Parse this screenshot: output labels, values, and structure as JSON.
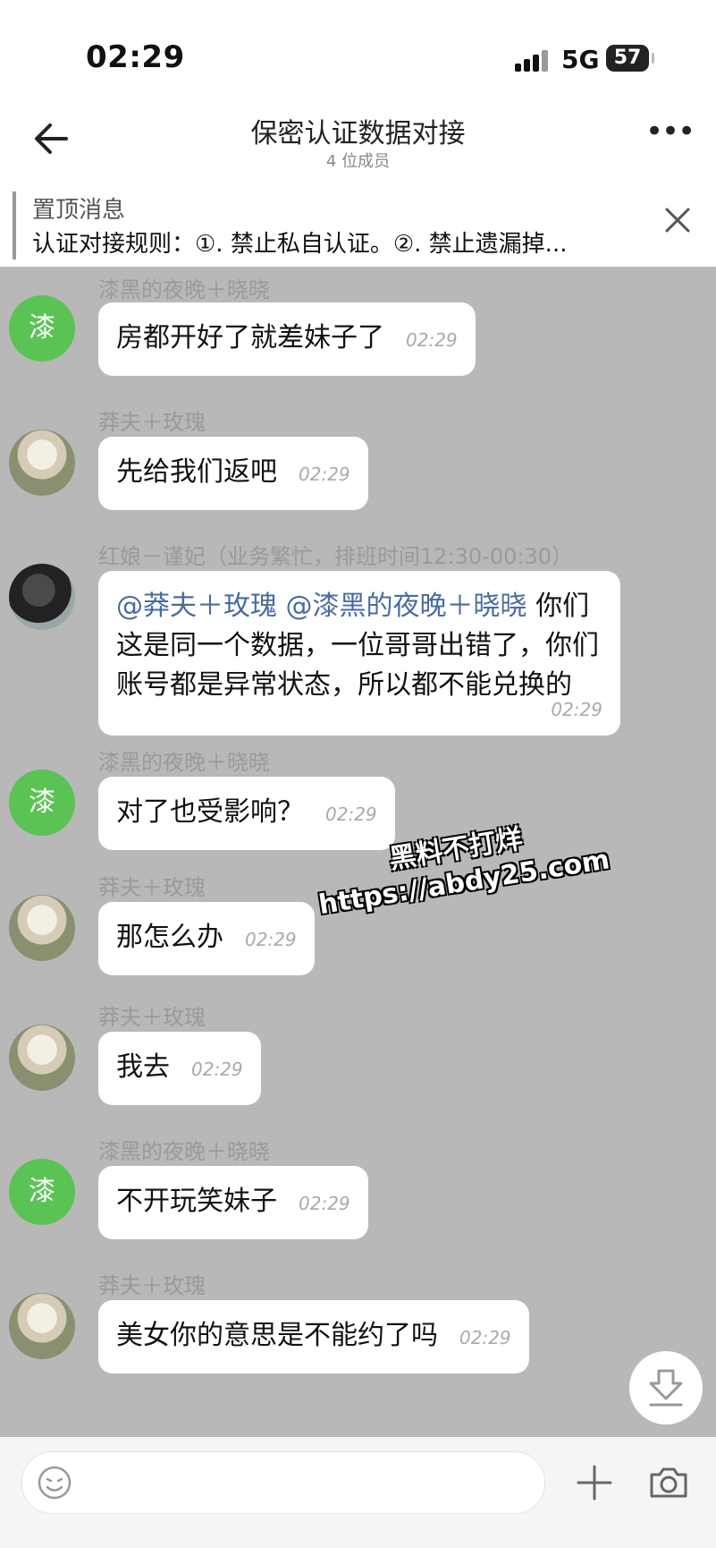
{
  "status": {
    "time": "02:29",
    "network": "5G",
    "battery": "57"
  },
  "header": {
    "title": "保密认证数据对接",
    "members": "4 位成员"
  },
  "pinned": {
    "label": "置顶消息",
    "text": "认证对接规则：①. 禁止私自认证。②. 禁止遗漏掉..."
  },
  "messages": [
    {
      "sender": "漆黑的夜晚＋晓晓",
      "avatar": "漆",
      "text": "房都开好了就差妹子了",
      "time": "02:29"
    },
    {
      "sender": "莽夫＋玫瑰",
      "text": "先给我们返吧",
      "time": "02:29"
    },
    {
      "sender": "红娘－谨妃（业务繁忙，排班时间12:30-00:30）",
      "mention1": "@莽夫＋玫瑰",
      "mention2": "@漆黑的夜晚＋晓晓",
      "text": "你们这是同一个数据，一位哥哥出错了，你们账号都是异常状态，所以都不能兑换的",
      "time": "02:29"
    },
    {
      "sender": "漆黑的夜晚＋晓晓",
      "avatar": "漆",
      "text": "对了也受影响？",
      "time": "02:29"
    },
    {
      "sender": "莽夫＋玫瑰",
      "text": "那怎么办",
      "time": "02:29"
    },
    {
      "sender": "莽夫＋玫瑰",
      "text": "我去",
      "time": "02:29"
    },
    {
      "sender": "漆黑的夜晚＋晓晓",
      "avatar": "漆",
      "text": "不开玩笑妹子",
      "time": "02:29"
    },
    {
      "sender": "莽夫＋玫瑰",
      "text": "美女你的意思是不能约了吗",
      "time": "02:29"
    }
  ],
  "watermark": {
    "line1": "黑料不打烊",
    "line2": "https://abdy25.com"
  },
  "icons": [
    "back-arrow-icon",
    "more-icon",
    "close-icon",
    "download-icon",
    "emoji-icon",
    "plus-icon",
    "camera-icon",
    "signal-icon"
  ]
}
